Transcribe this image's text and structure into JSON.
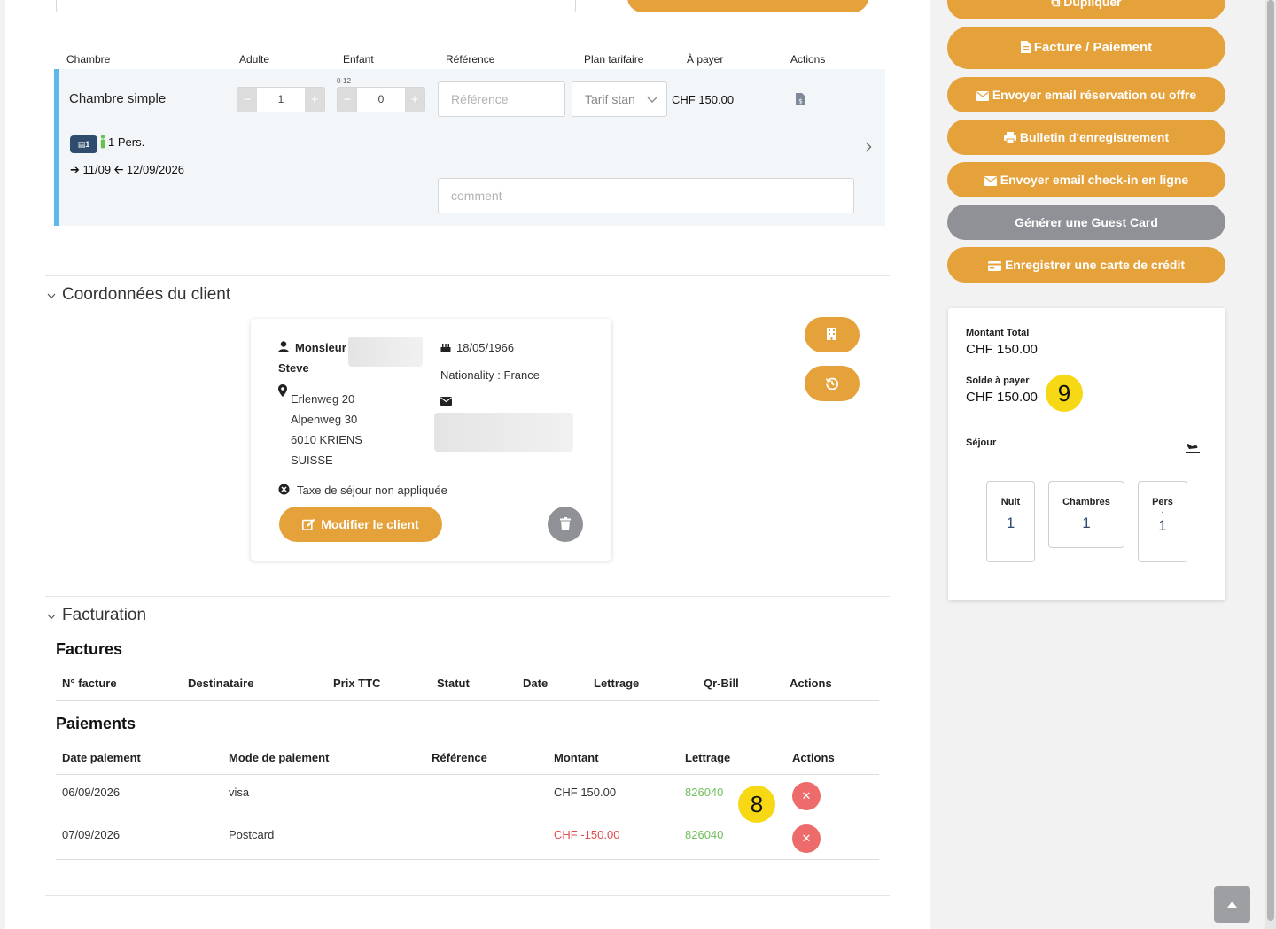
{
  "room_table": {
    "headers": [
      "Chambre",
      "Adulte",
      "Enfant",
      "Référence",
      "Plan tarifaire",
      "À payer",
      "Actions"
    ],
    "room_name": "Chambre simple",
    "adult_value": "1",
    "child_age_hint": "0-12",
    "child_value": "0",
    "reference_placeholder": "Référence",
    "rate_plan_value": "Tarif stan",
    "amount_due": "CHF 150.00",
    "bed_badge": "1",
    "persons": "1 Pers.",
    "arrival": "11/09",
    "departure": "12/09/2026",
    "comment_placeholder": "comment",
    "minus": "−",
    "plus": "+"
  },
  "client_section": {
    "title": "Coordonnées du client",
    "salutation": "Monsieur",
    "first_name": "Steve",
    "address": [
      "Erlenweg 20",
      "Alpenweg 30",
      "6010 KRIENS",
      "SUISSE"
    ],
    "birth_date": "18/05/1966",
    "nationality": "Nationality : France",
    "tax_note": "Taxe de séjour non appliquée",
    "edit_button": "Modifier le client"
  },
  "billing_section": {
    "title": "Facturation",
    "invoices_title": "Factures",
    "invoice_headers": [
      "N° facture",
      "Destinataire",
      "Prix TTC",
      "Statut",
      "Date",
      "Lettrage",
      "Qr-Bill",
      "Actions"
    ],
    "payments_title": "Paiements",
    "payment_headers": [
      "Date paiement",
      "Mode de paiement",
      "Référence",
      "Montant",
      "Lettrage",
      "Actions"
    ],
    "payments": [
      {
        "date": "06/09/2026",
        "mode": "visa",
        "reference": "",
        "amount": "CHF 150.00",
        "lettrage": "826040",
        "negative": false
      },
      {
        "date": "07/09/2026",
        "mode": "Postcard",
        "reference": "",
        "amount": "CHF -150.00",
        "lettrage": "826040",
        "negative": true
      }
    ],
    "marker": "8"
  },
  "sidebar": {
    "buttons": [
      {
        "label": "Dupliquer",
        "icon": "copy-icon"
      },
      {
        "label": "Facture / Paiement",
        "icon": "file-invoice-icon"
      },
      {
        "label": "Envoyer email réservation ou offre",
        "icon": "envelope-icon"
      },
      {
        "label": "Bulletin d'enregistrement",
        "icon": "print-icon"
      },
      {
        "label": "Envoyer email check-in en ligne",
        "icon": "envelope-icon"
      },
      {
        "label": "Générer une Guest Card",
        "icon": ""
      },
      {
        "label": "Enregistrer une carte de crédit",
        "icon": "credit-card-icon"
      }
    ],
    "summary": {
      "total_label": "Montant Total",
      "total_value": "CHF 150.00",
      "balance_label": "Solde à payer",
      "balance_value": "CHF 150.00",
      "marker": "9",
      "stay_label": "Séjour",
      "stats": [
        {
          "label": "Nuit",
          "value": "1"
        },
        {
          "label": "Chambres",
          "value": "1"
        },
        {
          "label": "Pers",
          "sub": ".",
          "value": "1"
        }
      ]
    }
  },
  "colors": {
    "accent": "#e5a23b",
    "gray_button": "#8f9196",
    "delete": "#ee6b6b",
    "room_bar": "#5fb7ec",
    "positive_green": "#6fbf5a",
    "negative_red": "#e24b4b"
  }
}
